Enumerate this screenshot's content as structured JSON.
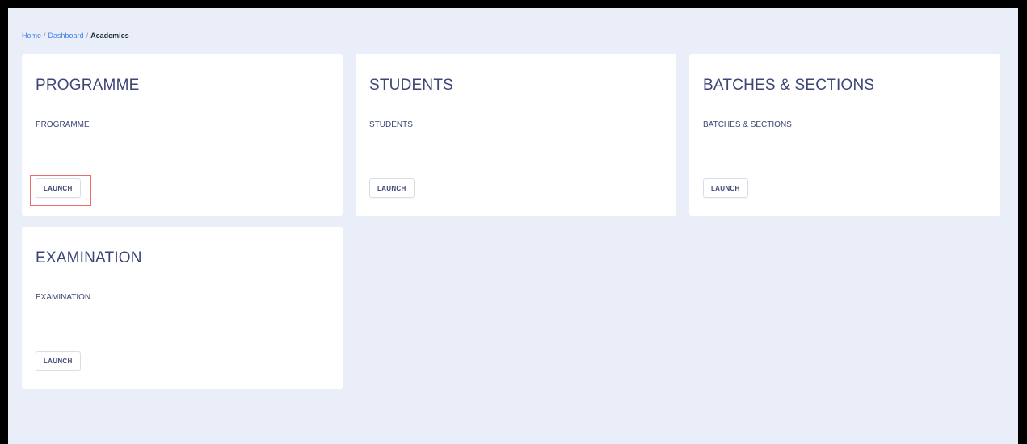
{
  "breadcrumb": {
    "home": "Home",
    "dashboard": "Dashboard",
    "current": "Academics",
    "separator": "/"
  },
  "cards": [
    {
      "title": "PROGRAMME",
      "subtitle": "PROGRAMME",
      "button": "LAUNCH"
    },
    {
      "title": "STUDENTS",
      "subtitle": "STUDENTS",
      "button": "LAUNCH"
    },
    {
      "title": "BATCHES & SECTIONS",
      "subtitle": "BATCHES & SECTIONS",
      "button": "LAUNCH"
    },
    {
      "title": "EXAMINATION",
      "subtitle": "EXAMINATION",
      "button": "LAUNCH"
    }
  ],
  "colors": {
    "background": "#e9eef8",
    "card": "#ffffff",
    "text": "#3d4577",
    "link": "#3b7ff0",
    "highlight": "#ef6b6b"
  }
}
